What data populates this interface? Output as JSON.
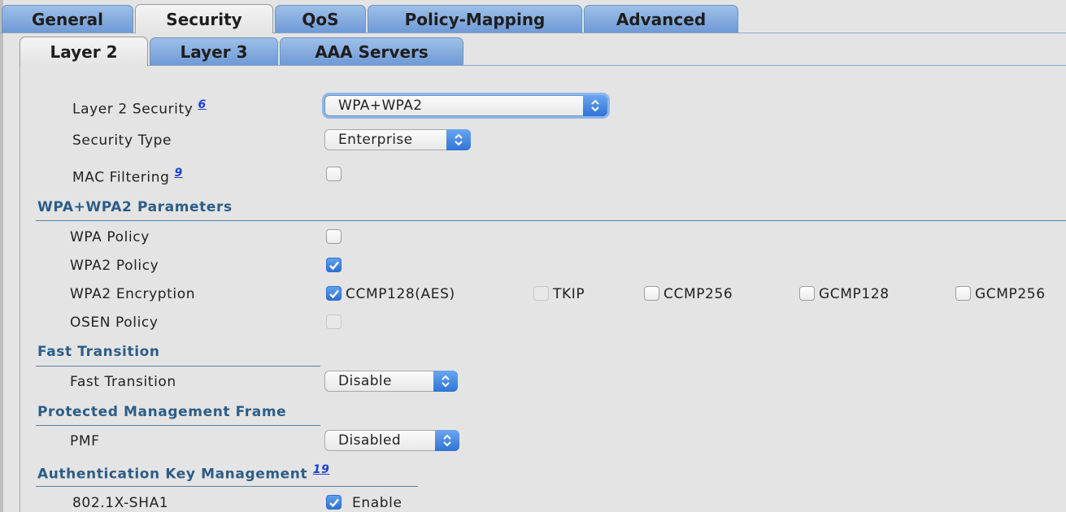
{
  "tabs": [
    "General",
    "Security",
    "QoS",
    "Policy-Mapping",
    "Advanced"
  ],
  "subtabs": [
    "Layer 2",
    "Layer 3",
    "AAA Servers"
  ],
  "form": {
    "layer2_security": {
      "label": "Layer 2 Security",
      "footnote": "6",
      "value": "WPA+WPA2"
    },
    "security_type": {
      "label": "Security Type",
      "value": "Enterprise"
    },
    "mac_filtering": {
      "label": "MAC Filtering",
      "footnote": "9"
    }
  },
  "wpa_section": {
    "title": "WPA+WPA2 Parameters",
    "wpa_policy": "WPA Policy",
    "wpa2_policy": "WPA2 Policy",
    "wpa2_encryption": {
      "label": "WPA2 Encryption",
      "options": [
        "CCMP128(AES)",
        "TKIP",
        "CCMP256",
        "GCMP128",
        "GCMP256"
      ]
    },
    "osen_policy": "OSEN Policy"
  },
  "fast_transition": {
    "title": "Fast Transition",
    "label": "Fast Transition",
    "value": "Disable"
  },
  "pmf": {
    "title": "Protected Management Frame",
    "label": "PMF",
    "value": "Disabled"
  },
  "akm": {
    "title": "Authentication Key Management",
    "footnote": "19",
    "sha1_label": "802.1X-SHA1",
    "enable_label": "Enable"
  },
  "colors": {
    "tab_blue": "#6f9ad6",
    "section_text": "#2c5d87",
    "link": "#1b3fd6",
    "checkbox_checked": "#2e6fd0"
  }
}
